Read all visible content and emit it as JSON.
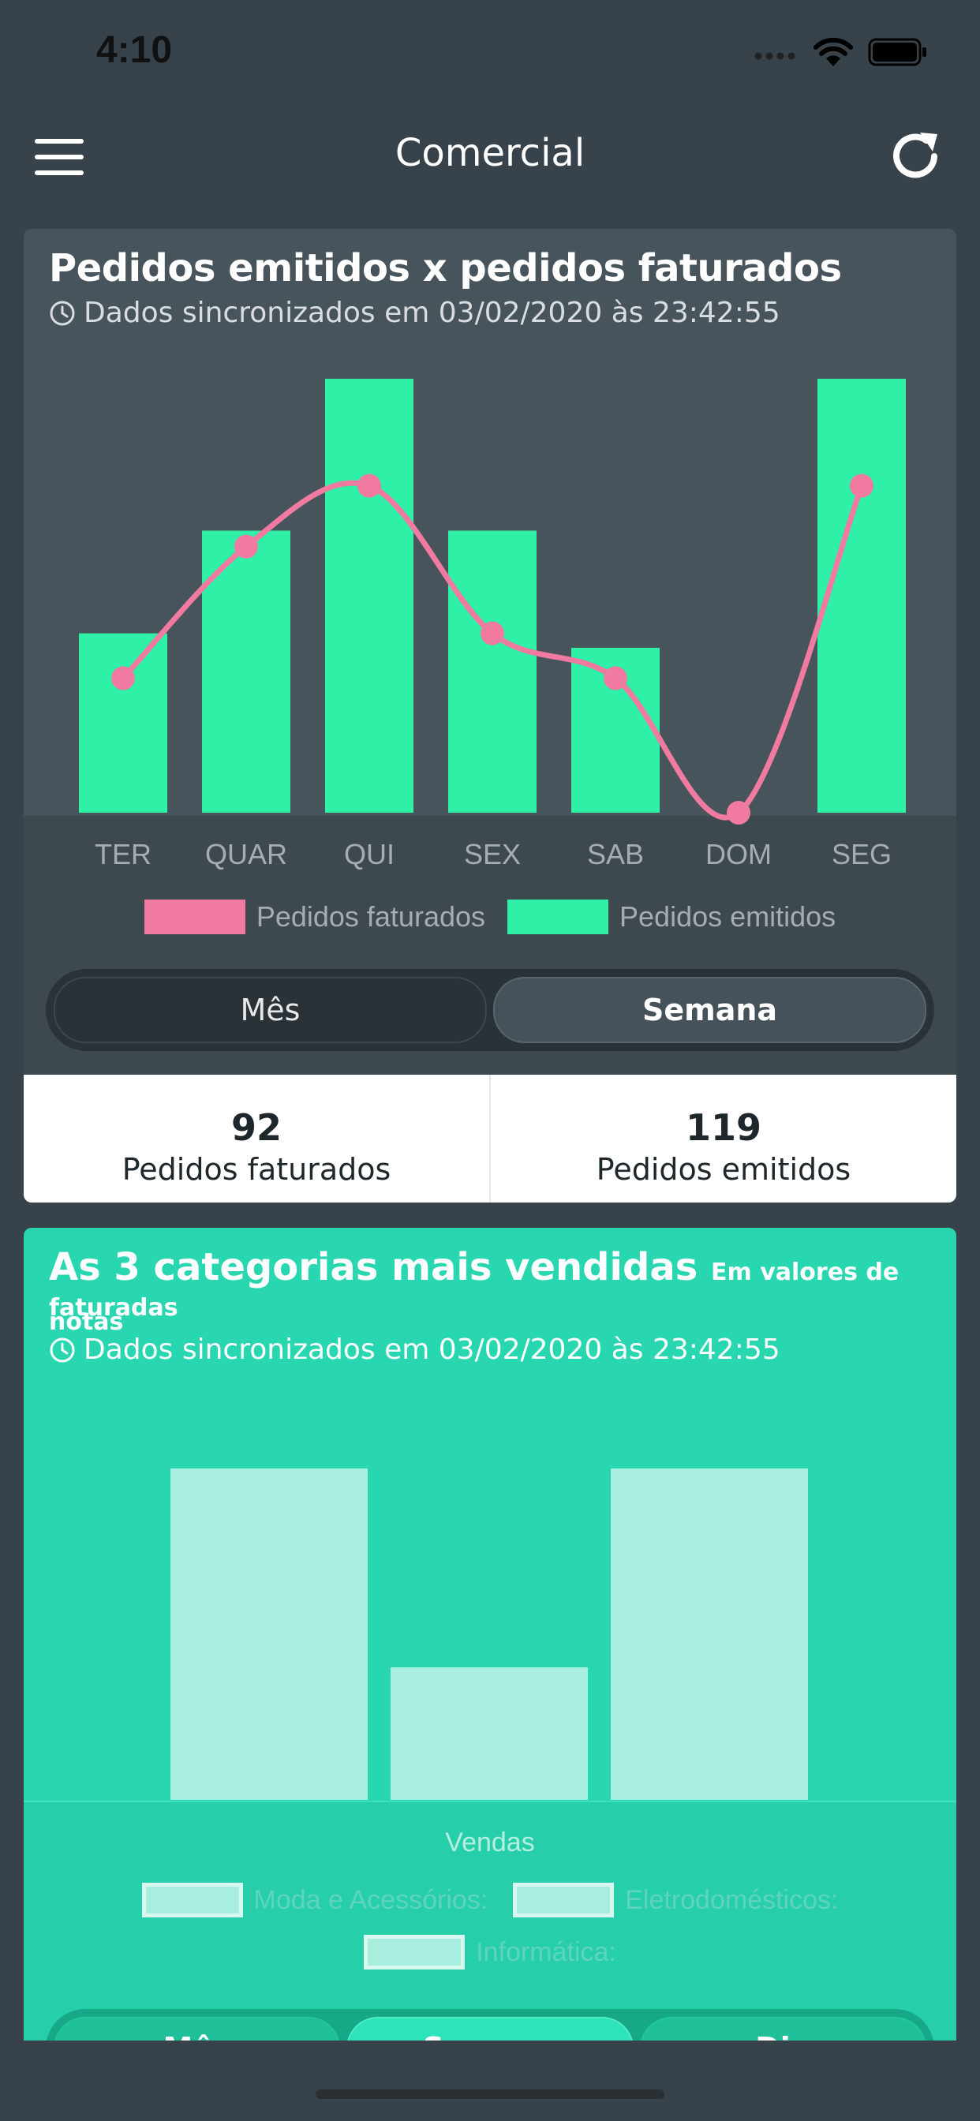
{
  "status_bar": {
    "time": "4:10"
  },
  "nav": {
    "title": "Comercial"
  },
  "card1": {
    "title": "Pedidos emitidos x pedidos faturados",
    "sync": "Dados sincronizados em 03/02/2020 às 23:42:55",
    "segments": [
      "Mês",
      "Semana"
    ],
    "active_segment": "Semana",
    "summary": [
      {
        "value": "92",
        "label": "Pedidos faturados"
      },
      {
        "value": "119",
        "label": "Pedidos emitidos"
      }
    ]
  },
  "card2": {
    "title": "As 3 categorias mais vendidas",
    "title_suffix": "Em valores de notas",
    "subtitle": "faturadas",
    "sync": "Dados sincronizados em 03/02/2020 às 23:42:55",
    "segments": [
      "Mês",
      "Semana",
      "Dia"
    ]
  },
  "chart_data": [
    {
      "type": "bar",
      "categories": [
        "TER",
        "QUAR",
        "QUI",
        "SEX",
        "SAB",
        "DOM",
        "SEG"
      ],
      "ylim": [
        0,
        30
      ],
      "series": [
        {
          "name": "Pedidos emitidos",
          "type": "bar",
          "color": "#2ef0a7",
          "values": [
            12.4,
            19.5,
            30,
            19.5,
            11.4,
            0,
            30
          ]
        },
        {
          "name": "Pedidos faturados",
          "type": "line",
          "color": "#f07aa0",
          "values": [
            9.3,
            18.4,
            22.6,
            12.4,
            9.3,
            0,
            22.6
          ]
        }
      ],
      "legend": [
        "Pedidos faturados",
        "Pedidos emitidos"
      ],
      "legend_position": "bottom"
    },
    {
      "type": "bar",
      "categories": [
        "Moda e Acessórios:",
        "Eletrodomésticos:",
        "Informática:"
      ],
      "xlabel": "Vendas",
      "ylim": [
        0,
        100
      ],
      "series": [
        {
          "name": "Vendas",
          "color": "#a7eedf",
          "values": [
            100,
            40,
            100
          ]
        }
      ],
      "legend_position": "bottom"
    }
  ]
}
